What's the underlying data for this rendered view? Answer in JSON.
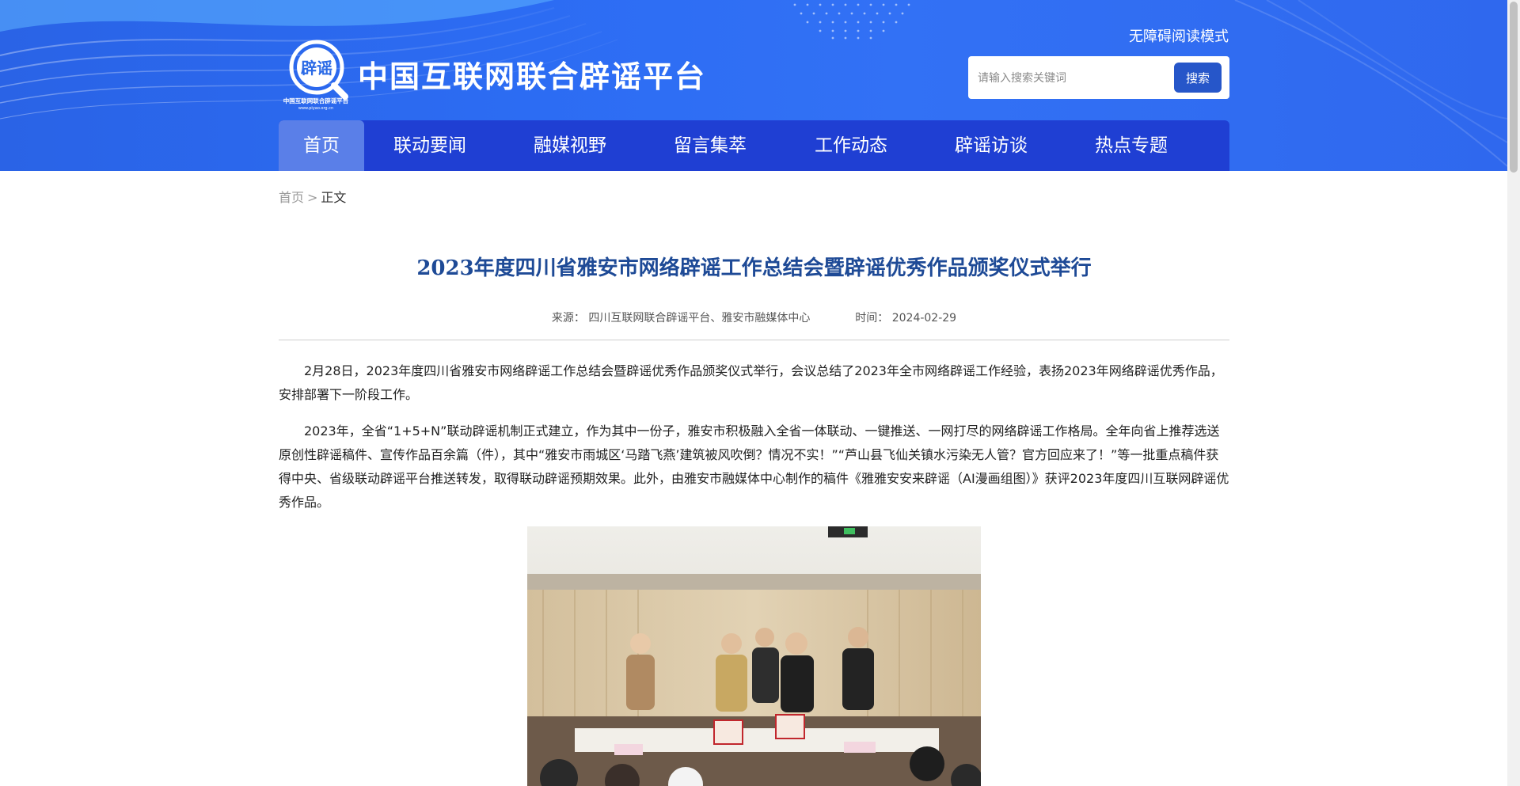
{
  "header": {
    "site_title": "中国互联网联合辟谣平台",
    "logo_text": "辟谣",
    "logo_caption": "中国互联网联合辟谣平台",
    "logo_url": "www.piyao.org.cn",
    "accessibility_label": "无障碍阅读模式",
    "search": {
      "placeholder": "请输入搜索关键词",
      "button_label": "搜索"
    },
    "colors": {
      "header_bg": "#2c6cf3",
      "nav_bg": "#1f3fd3",
      "nav_active_bg": "#5a7fe8",
      "search_button": "#2656c9"
    }
  },
  "nav": {
    "items": [
      {
        "label": "首页",
        "active": true
      },
      {
        "label": "联动要闻",
        "active": false
      },
      {
        "label": "融媒视野",
        "active": false
      },
      {
        "label": "留言集萃",
        "active": false
      },
      {
        "label": "工作动态",
        "active": false
      },
      {
        "label": "辟谣访谈",
        "active": false
      },
      {
        "label": "热点专题",
        "active": false
      }
    ]
  },
  "breadcrumb": {
    "home": "首页",
    "separator": ">",
    "current": "正文"
  },
  "article": {
    "title": "2023年度四川省雅安市网络辟谣工作总结会暨辟谣优秀作品颁奖仪式举行",
    "source_label": "来源：",
    "source": "四川互联网联合辟谣平台、雅安市融媒体中心",
    "time_label": "时间：",
    "time": "2024-02-29",
    "title_color": "#1e4a96",
    "paragraphs": [
      "2月28日，2023年度四川省雅安市网络辟谣工作总结会暨辟谣优秀作品颁奖仪式举行，会议总结了2023年全市网络辟谣工作经验，表扬2023年网络辟谣优秀作品，安排部署下一阶段工作。",
      "2023年，全省“1+5+N”联动辟谣机制正式建立，作为其中一份子，雅安市积极融入全省一体联动、一键推送、一网打尽的网络辟谣工作格局。全年向省上推荐选送原创性辟谣稿件、宣传作品百余篇（件），其中“雅安市雨城区‘马踏飞燕’建筑被风吹倒？情况不实！”“芦山县飞仙关镇水污染无人管？官方回应来了！”等一批重点稿件获得中央、省级联动辟谣平台推送转发，取得联动辟谣预期效果。此外，由雅安市融媒体中心制作的稿件《雅雅安安来辟谣（AI漫画组图）》获评2023年度四川互联网辟谣优秀作品。"
    ],
    "photo_icon": "award-ceremony-photo"
  }
}
